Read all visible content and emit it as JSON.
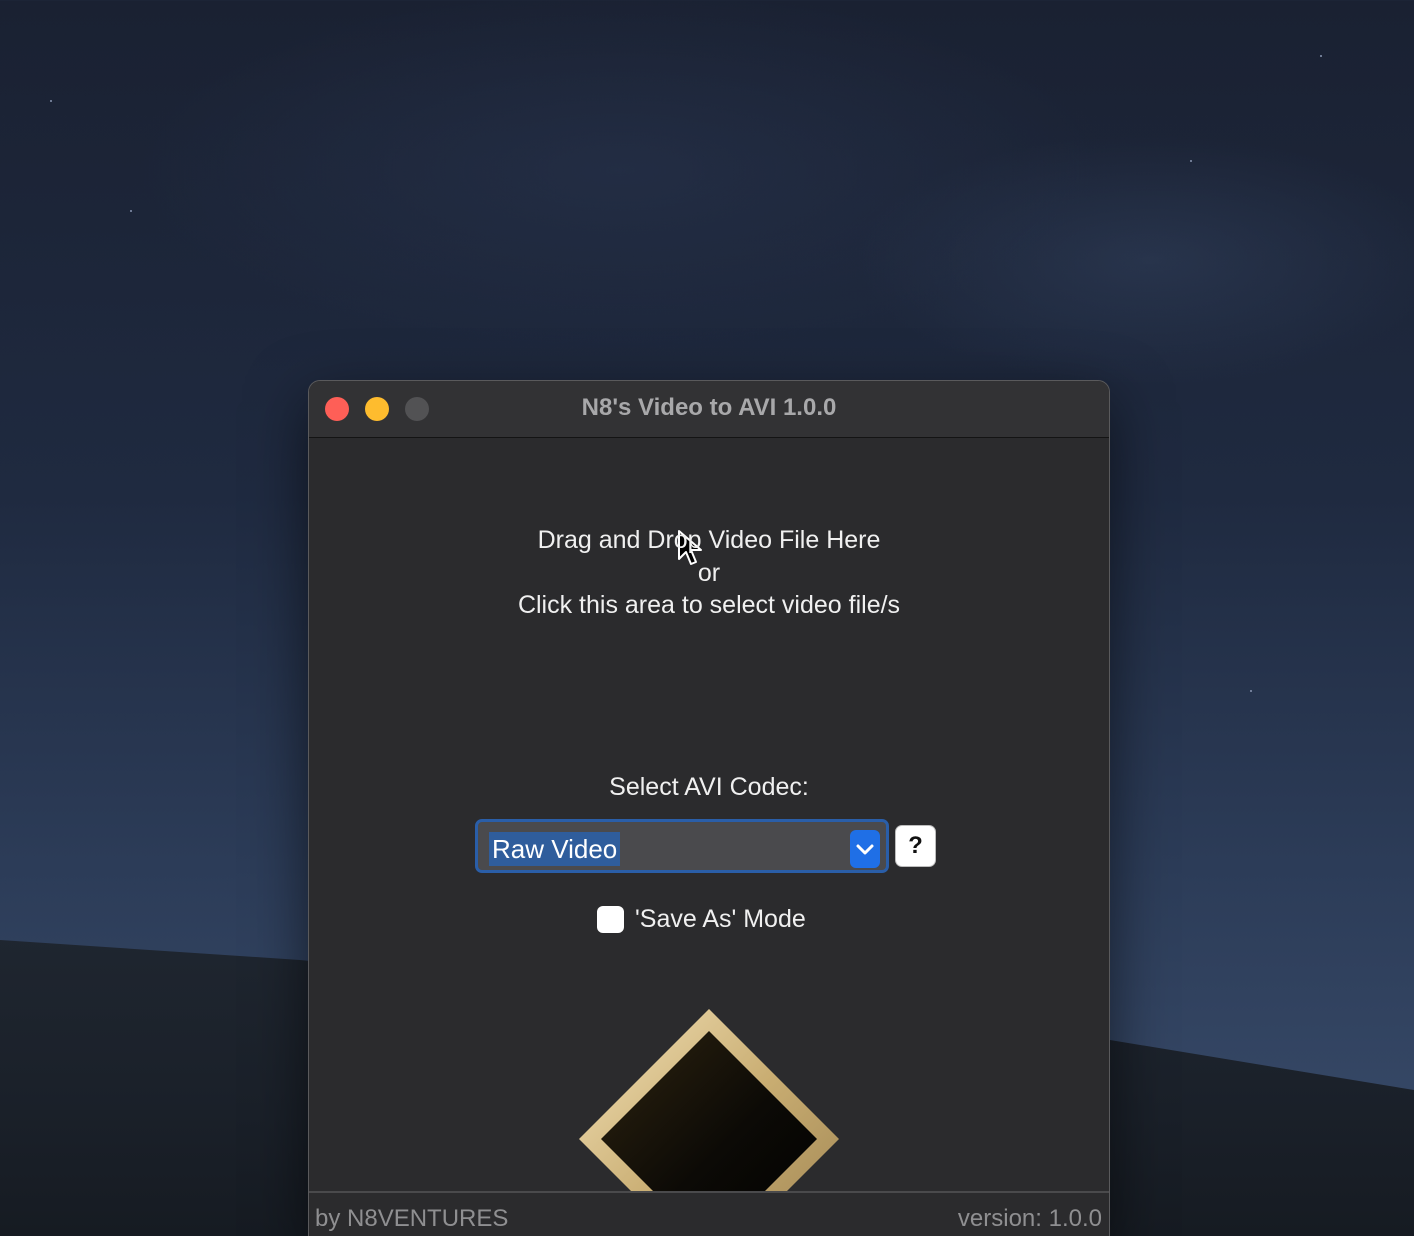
{
  "window": {
    "title": "N8's Video to AVI 1.0.0"
  },
  "dropzone": {
    "line1": "Drag and Drop Video File Here",
    "line2": "or",
    "line3": "Click this area to select video file/s"
  },
  "codec": {
    "label": "Select AVI Codec:",
    "selected": "Raw Video",
    "help_label": "?"
  },
  "save_as": {
    "label": "'Save As' Mode",
    "checked": false
  },
  "footer": {
    "left": "by N8VENTURES",
    "right": "version: 1.0.0"
  },
  "colors": {
    "accent": "#1f6fe6",
    "selection": "#2f5d9c",
    "close": "#fe5f57",
    "minimize": "#febc2e",
    "window_bg": "#2b2b2d",
    "logo_gold": "#d8c08a"
  },
  "icons": [
    "close-icon",
    "minimize-icon",
    "maximize-icon",
    "cursor-icon",
    "chevron-down-icon",
    "app-logo-icon"
  ]
}
